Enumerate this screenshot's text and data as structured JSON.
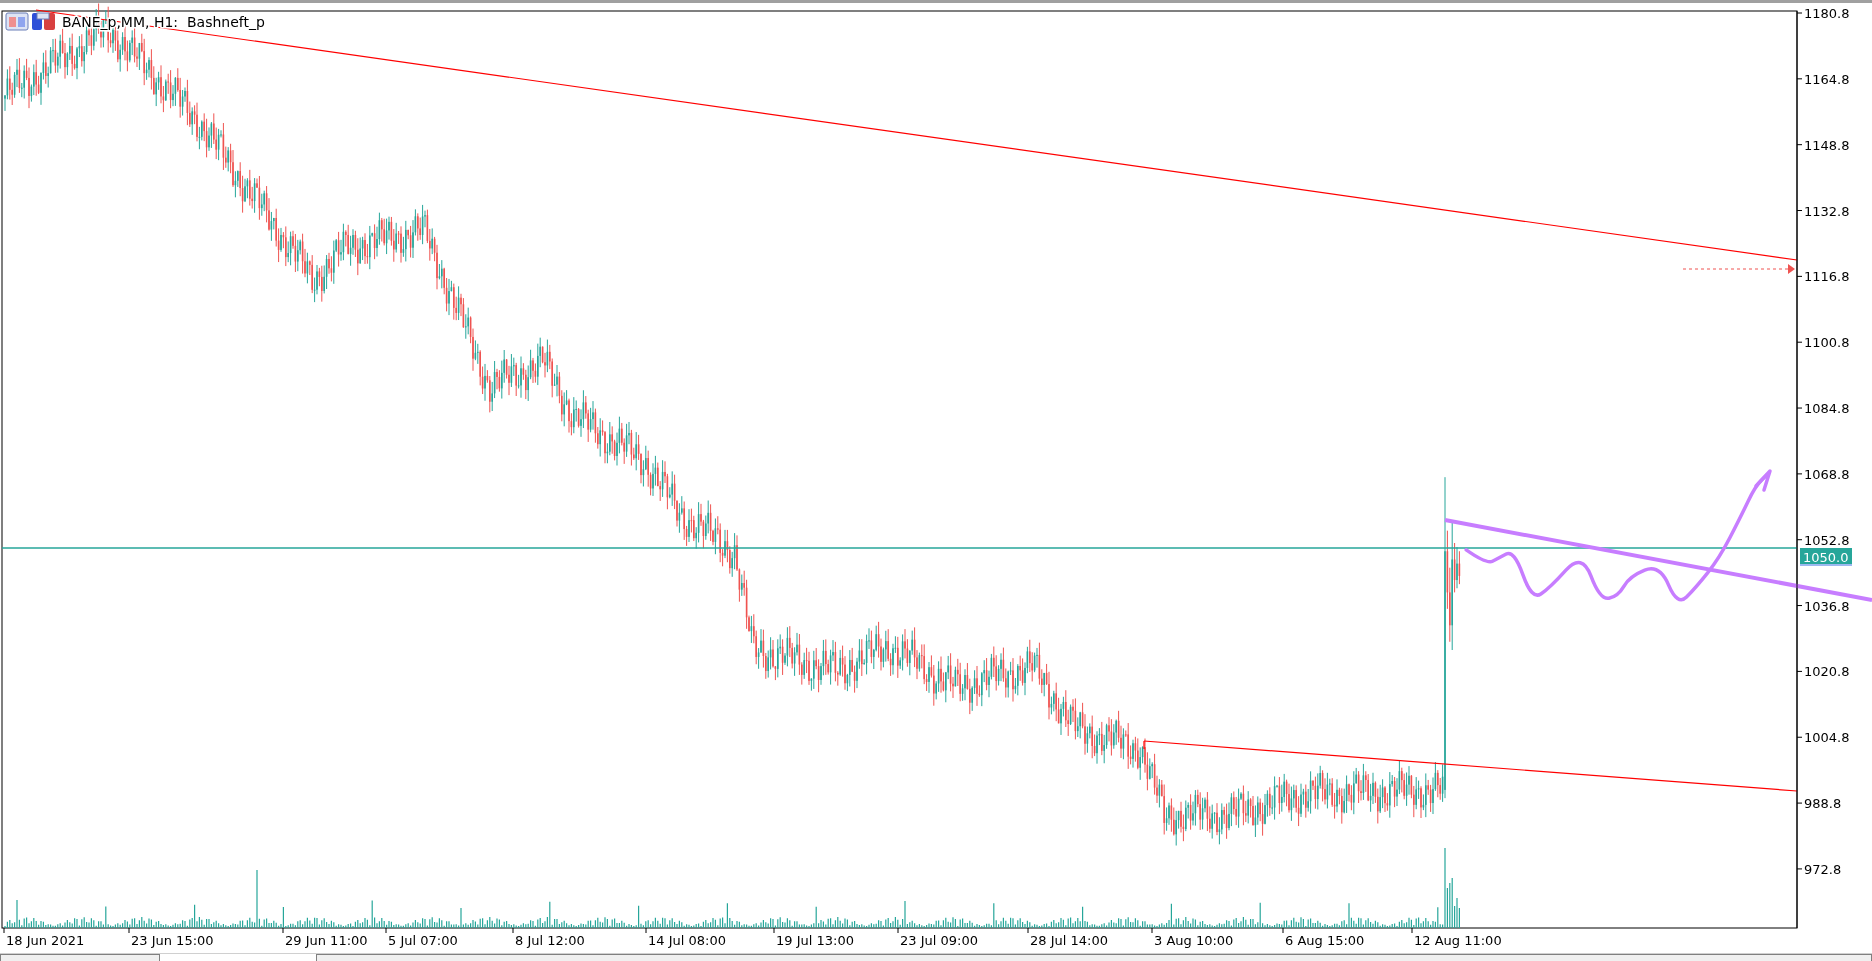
{
  "chart": {
    "title": "BANE_p,MM, H1:  Bashneft_p",
    "price_axis": [
      "1180.8",
      "1164.8",
      "1148.8",
      "1132.8",
      "1116.8",
      "1100.8",
      "1084.8",
      "1068.8",
      "1052.8",
      "1036.8",
      "1020.8",
      "1004.8",
      "988.8",
      "972.8"
    ],
    "current_price": "1050.0",
    "time_axis": [
      "18 Jun 2021",
      "23 Jun 15:00",
      "29 Jun 11:00",
      "5 Jul 07:00",
      "8 Jul 12:00",
      "14 Jul 08:00",
      "19 Jul 13:00",
      "23 Jul 09:00",
      "28 Jul 14:00",
      "3 Aug 10:00",
      "6 Aug 15:00",
      "12 Aug 11:00"
    ]
  },
  "tabs": [
    {
      "selected": false
    },
    {
      "selected": true
    },
    {
      "selected": false
    }
  ]
}
